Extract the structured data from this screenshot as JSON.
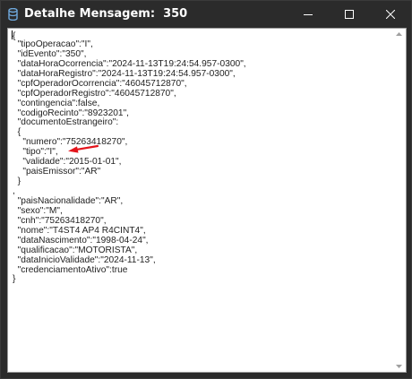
{
  "window": {
    "title": "Detalhe Mensagem:  350",
    "app_icon": "database-icon",
    "controls": {
      "minimize": "minimize-icon",
      "maximize": "maximize-icon",
      "close": "close-icon"
    }
  },
  "json_text": {
    "lines": [
      "{",
      "  \"tipoOperacao\":\"I\",",
      "  \"idEvento\":\"350\",",
      "  \"dataHoraOcorrencia\":\"2024-11-13T19:24:54.957-0300\",",
      "  \"dataHoraRegistro\":\"2024-11-13T19:24:54.957-0300\",",
      "  \"cpfOperadorOcorrencia\":\"46045712870\",",
      "  \"cpfOperadorRegistro\":\"46045712870\",",
      "  \"contingencia\":false,",
      "  \"codigoRecinto\":\"8923201\",",
      "  \"documentoEstrangeiro\":",
      "  {",
      "    \"numero\":\"75263418270\",",
      "    \"tipo\":\"I\",",
      "    \"validade\":\"2015-01-01\",",
      "    \"paisEmissor\":\"AR\"",
      "  }",
      ",",
      "  \"paisNacionalidade\":\"AR\",",
      "  \"sexo\":\"M\",",
      "  \"cnh\":\"75263418270\",",
      "  \"nome\":\"T4ST4 AP4 R4CINT4\",",
      "  \"dataNascimento\":\"1998-04-24\",",
      "  \"qualificacao\":\"MOTORISTA\",",
      "  \"dataInicioValidade\":\"2024-11-13\",",
      "  \"credenciamentoAtivo\":true",
      "}"
    ]
  },
  "annotation": {
    "icon": "red-arrow-icon",
    "color": "#e3141b"
  },
  "colors": {
    "titlebar": "#2b2b2b",
    "text": "#222222",
    "content_bg": "#ffffff"
  }
}
